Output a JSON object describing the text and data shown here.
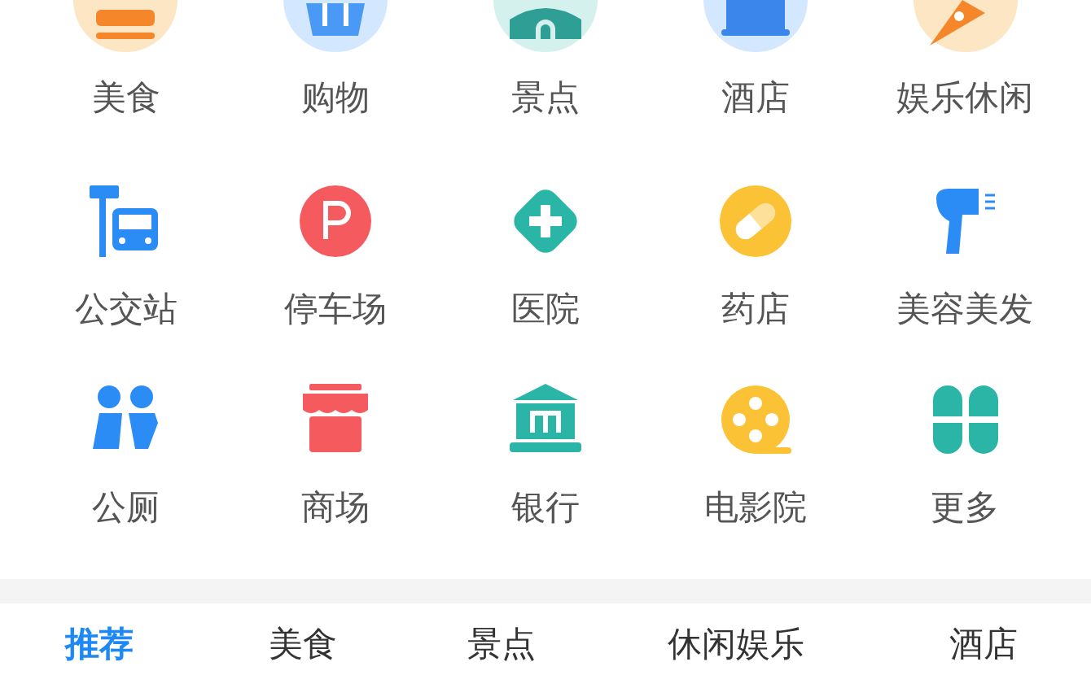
{
  "categories": [
    {
      "label": "美食"
    },
    {
      "label": "购物"
    },
    {
      "label": "景点"
    },
    {
      "label": "酒店"
    },
    {
      "label": "娱乐休闲"
    },
    {
      "label": "公交站"
    },
    {
      "label": "停车场"
    },
    {
      "label": "医院"
    },
    {
      "label": "药店"
    },
    {
      "label": "美容美发"
    },
    {
      "label": "公厕"
    },
    {
      "label": "商场"
    },
    {
      "label": "银行"
    },
    {
      "label": "电影院"
    },
    {
      "label": "更多"
    }
  ],
  "tabs": [
    {
      "label": "推荐",
      "selected": true
    },
    {
      "label": "美食",
      "selected": false
    },
    {
      "label": "景点",
      "selected": false
    },
    {
      "label": "休闲娱乐",
      "selected": false
    },
    {
      "label": "酒店",
      "selected": false
    }
  ]
}
